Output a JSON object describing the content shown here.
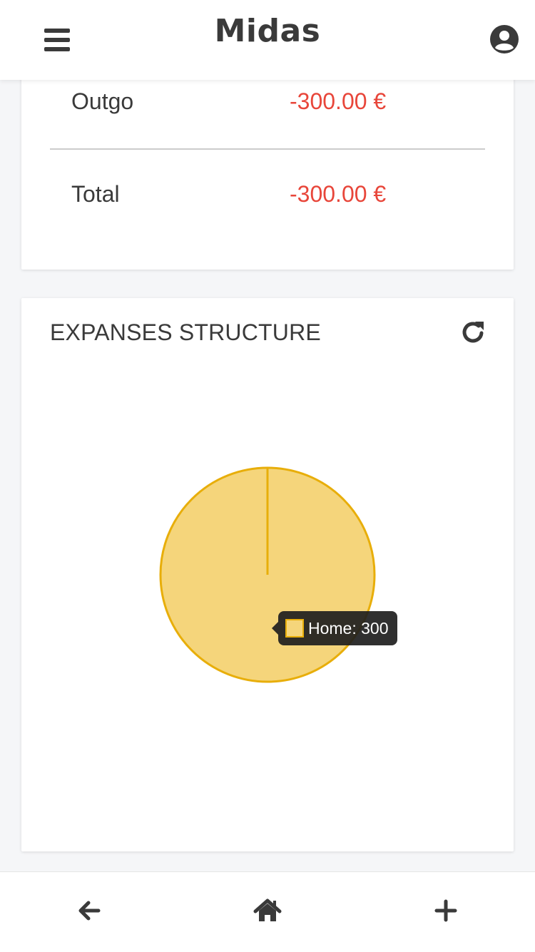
{
  "app": {
    "title": "Midas"
  },
  "header": {
    "menu_icon": "hamburger-menu-icon",
    "profile_icon": "user-circle-icon"
  },
  "summary": {
    "rows": [
      {
        "label": "Outgo",
        "value": "-300.00 €"
      },
      {
        "label": "Total",
        "value": "-300.00 €"
      }
    ]
  },
  "chart_section": {
    "title": "EXPANSES STRUCTURE",
    "refresh_icon": "refresh-icon",
    "tooltip": "Home: 300"
  },
  "chart_data": {
    "type": "pie",
    "title": "",
    "slices": [
      {
        "label": "Home",
        "value": 300
      }
    ]
  },
  "colors": {
    "negative": "#e8463a",
    "slice_fill": "#f5d57b",
    "slice_border": "#e8ae0a",
    "text": "#3a3a3a"
  },
  "bottom_nav": {
    "items": [
      {
        "icon": "arrow-left-icon"
      },
      {
        "icon": "home-icon"
      },
      {
        "icon": "plus-icon"
      }
    ]
  }
}
